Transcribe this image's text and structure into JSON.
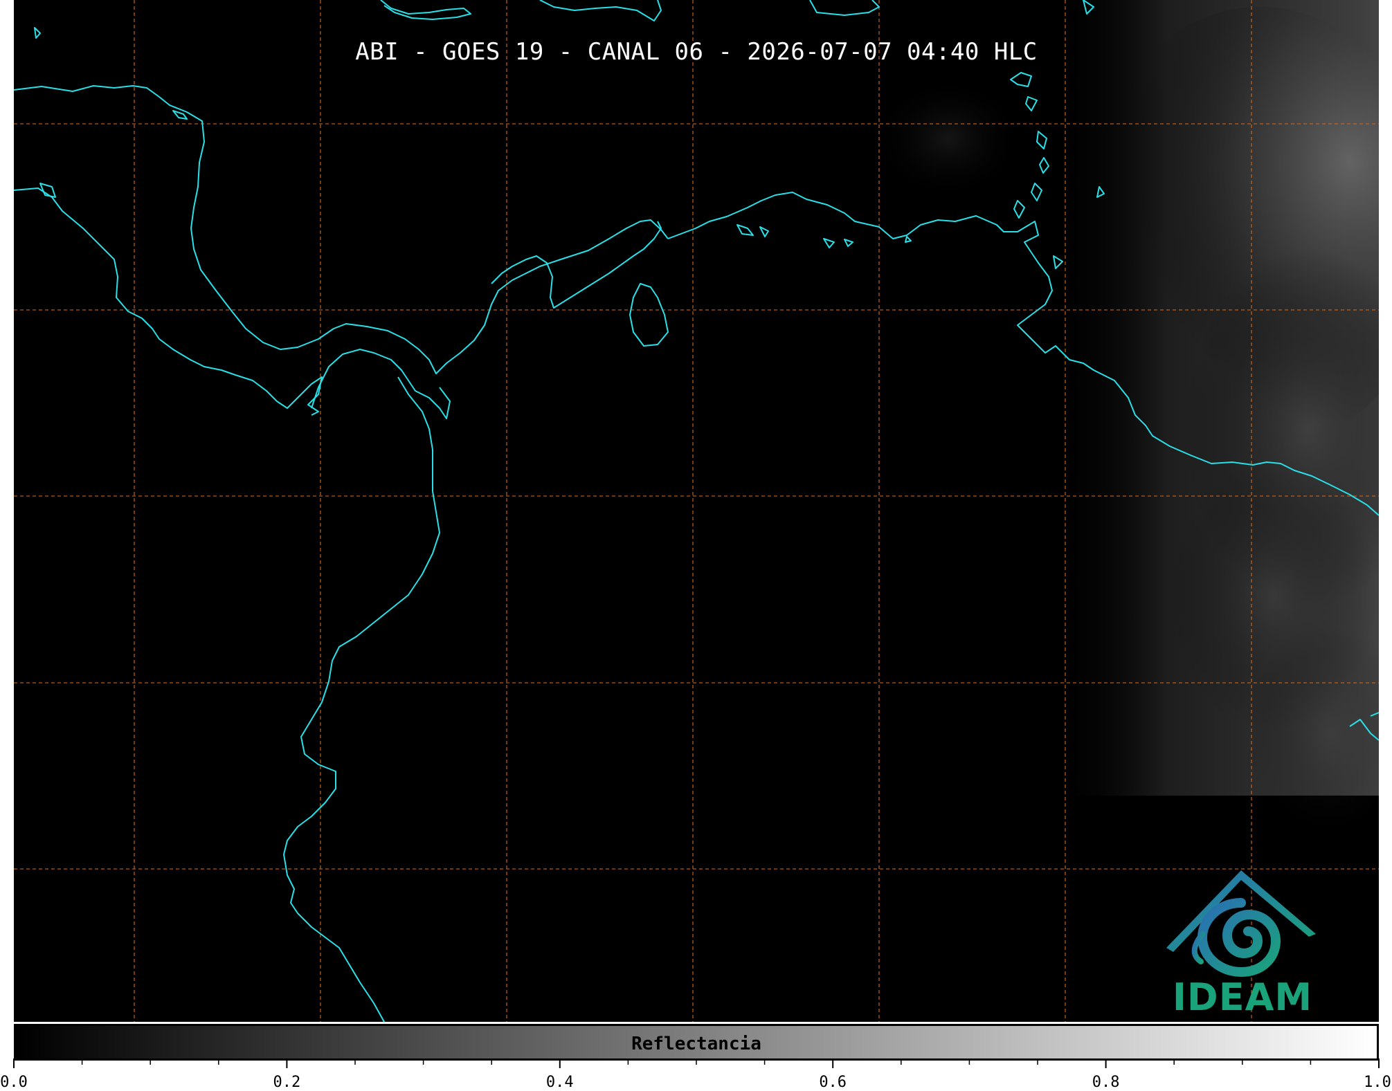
{
  "map": {
    "title": "ABI - GOES 19 - CANAL 06 - 2026-07-07 04:40 HLC",
    "background_color": "#000000",
    "coastline_color": "#29e0e8",
    "gridline_color": "#d2691e",
    "gridlines": "dashed"
  },
  "logo": {
    "text": "IDEAM",
    "colors": [
      "#2a6fb5",
      "#1aa37a"
    ]
  },
  "colorbar": {
    "label": "Reflectancia",
    "min": 0.0,
    "max": 1.0,
    "colormap": "gray",
    "tick_labels": [
      "0.0",
      "0.2",
      "0.4",
      "0.6",
      "0.8",
      "1.0"
    ],
    "tick_values": [
      0.0,
      0.2,
      0.4,
      0.6,
      0.8,
      1.0
    ]
  }
}
